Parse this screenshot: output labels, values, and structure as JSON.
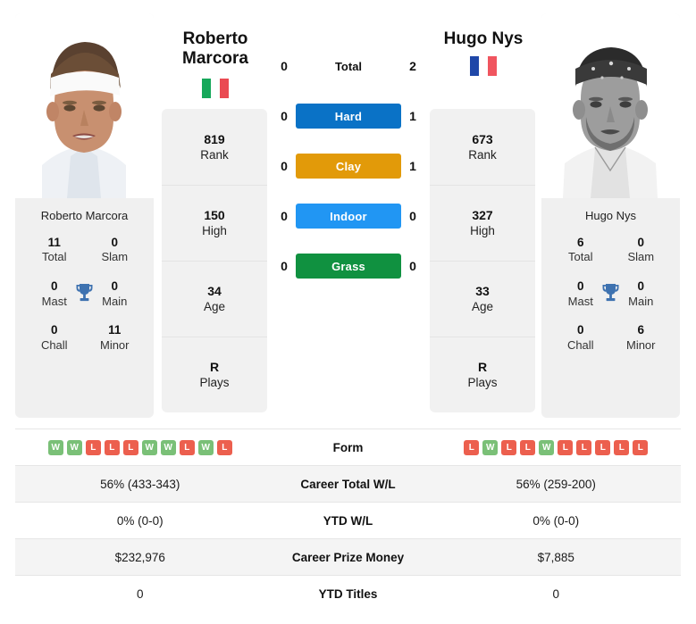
{
  "players": {
    "left": {
      "name": "Roberto Marcora",
      "name_line1": "Roberto",
      "name_line2": "Marcora",
      "caption": "Roberto Marcora",
      "country": "Italy",
      "flag_colors": [
        "#16a85a",
        "#ffffff",
        "#ea4a52"
      ],
      "rank": "819",
      "rank_label": "Rank",
      "high": "150",
      "high_label": "High",
      "age": "34",
      "age_label": "Age",
      "plays": "R",
      "plays_label": "Plays",
      "titles": {
        "total": "11",
        "total_label": "Total",
        "slam": "0",
        "slam_label": "Slam",
        "mast": "0",
        "mast_label": "Mast",
        "main": "0",
        "main_label": "Main",
        "chall": "0",
        "chall_label": "Chall",
        "minor": "11",
        "minor_label": "Minor"
      },
      "form": [
        "W",
        "W",
        "L",
        "L",
        "L",
        "W",
        "W",
        "L",
        "W",
        "L"
      ],
      "career_total_wl": "56% (433-343)",
      "ytd_wl": "0% (0-0)",
      "career_prize_money": "$232,976",
      "ytd_titles": "0"
    },
    "right": {
      "name": "Hugo Nys",
      "name_line1": "Hugo Nys",
      "name_line2": "",
      "caption": "Hugo Nys",
      "country": "France",
      "flag_colors": [
        "#1f47a8",
        "#ffffff",
        "#f0555f"
      ],
      "rank": "673",
      "rank_label": "Rank",
      "high": "327",
      "high_label": "High",
      "age": "33",
      "age_label": "Age",
      "plays": "R",
      "plays_label": "Plays",
      "titles": {
        "total": "6",
        "total_label": "Total",
        "slam": "0",
        "slam_label": "Slam",
        "mast": "0",
        "mast_label": "Mast",
        "main": "0",
        "main_label": "Main",
        "chall": "0",
        "chall_label": "Chall",
        "minor": "6",
        "minor_label": "Minor"
      },
      "form": [
        "L",
        "W",
        "L",
        "L",
        "W",
        "L",
        "L",
        "L",
        "L",
        "L"
      ],
      "career_total_wl": "56% (259-200)",
      "ytd_wl": "0% (0-0)",
      "career_prize_money": "$7,885",
      "ytd_titles": "0"
    }
  },
  "h2h": {
    "rows": [
      {
        "label": "Total",
        "left": "0",
        "right": "2",
        "style": "plain",
        "color": ""
      },
      {
        "label": "Hard",
        "left": "0",
        "right": "1",
        "style": "badge",
        "color": "#0a72c6"
      },
      {
        "label": "Clay",
        "left": "0",
        "right": "1",
        "style": "badge",
        "color": "#e29a09"
      },
      {
        "label": "Indoor",
        "left": "0",
        "right": "0",
        "style": "badge",
        "color": "#2196f3"
      },
      {
        "label": "Grass",
        "left": "0",
        "right": "0",
        "style": "badge",
        "color": "#109140"
      }
    ]
  },
  "table": {
    "rows": [
      {
        "label": "Form",
        "key": "form",
        "type": "form"
      },
      {
        "label": "Career Total W/L",
        "key": "career_total_wl",
        "type": "text"
      },
      {
        "label": "YTD W/L",
        "key": "ytd_wl",
        "type": "text"
      },
      {
        "label": "Career Prize Money",
        "key": "career_prize_money",
        "type": "text"
      },
      {
        "label": "YTD Titles",
        "key": "ytd_titles",
        "type": "text"
      }
    ]
  },
  "colors": {
    "win_badge": "#7ac077",
    "loss_badge": "#ec5f4e",
    "trophy": "#3e72b0",
    "card_bg": "#f0f0f0"
  }
}
